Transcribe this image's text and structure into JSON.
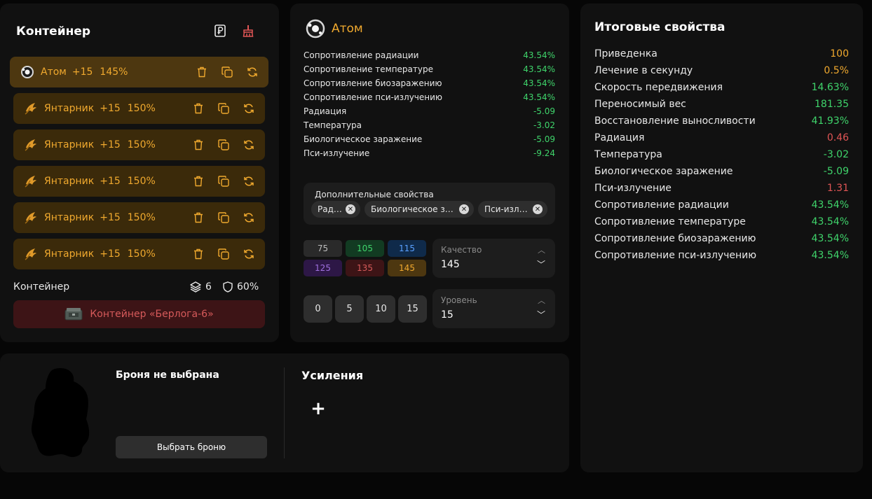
{
  "container_panel": {
    "title": "Контейнер",
    "artifacts": [
      {
        "name": "Атом",
        "level": "+15",
        "quality": "145%",
        "active": true
      },
      {
        "name": "Янтарник",
        "level": "+15",
        "quality": "150%",
        "active": false
      },
      {
        "name": "Янтарник",
        "level": "+15",
        "quality": "150%",
        "active": false
      },
      {
        "name": "Янтарник",
        "level": "+15",
        "quality": "150%",
        "active": false
      },
      {
        "name": "Янтарник",
        "level": "+15",
        "quality": "150%",
        "active": false
      },
      {
        "name": "Янтарник",
        "level": "+15",
        "quality": "150%",
        "active": false
      }
    ],
    "footer_label": "Контейнер",
    "slots": "6",
    "protection": "60%",
    "selected_container": "Контейнер «Берлога-6»"
  },
  "artifact_panel": {
    "name": "Атом",
    "properties": [
      {
        "label": "Сопротивление радиации",
        "value": "43.54%"
      },
      {
        "label": "Сопротивление температуре",
        "value": "43.54%"
      },
      {
        "label": "Сопротивление биозаражению",
        "value": "43.54%"
      },
      {
        "label": "Сопротивление пси-излучению",
        "value": "43.54%"
      },
      {
        "label": "Радиация",
        "value": "-5.09"
      },
      {
        "label": "Температура",
        "value": "-3.02"
      },
      {
        "label": "Биологическое заражение",
        "value": "-5.09"
      },
      {
        "label": "Пси-излучение",
        "value": "-9.24"
      }
    ],
    "extra_title": "Дополнительные свойства",
    "extra_chips": [
      "Радиация",
      "Биологическое заражение",
      "Пси-излучение"
    ],
    "quality_buttons": [
      {
        "label": "75",
        "bg": "#2a2a2a",
        "fg": "#bdbdbd"
      },
      {
        "label": "105",
        "bg": "#123b22",
        "fg": "#3fd46b"
      },
      {
        "label": "115",
        "bg": "#0f2a4a",
        "fg": "#5aa0ff"
      },
      {
        "label": "125",
        "bg": "#2d1746",
        "fg": "#a070e0"
      },
      {
        "label": "135",
        "bg": "#3d1416",
        "fg": "#d65a5a"
      },
      {
        "label": "145",
        "bg": "#4d3710",
        "fg": "#f0a92e"
      }
    ],
    "quality_label": "Качество",
    "quality_value": "145",
    "level_buttons": [
      "0",
      "5",
      "10",
      "15"
    ],
    "level_label": "Уровень",
    "level_value": "15"
  },
  "totals_panel": {
    "title": "Итоговые свойства",
    "rows": [
      {
        "label": "Приведенка",
        "value": "100",
        "color": "#f0a92e"
      },
      {
        "label": "Лечение в секунду",
        "value": "0.5%",
        "color": "#f0a92e"
      },
      {
        "label": "Скорость передвижения",
        "value": "14.63%",
        "color": "#3fd46b"
      },
      {
        "label": "Переносимый вес",
        "value": "181.35",
        "color": "#3fd46b"
      },
      {
        "label": "Восстановление выносливости",
        "value": "41.93%",
        "color": "#3fd46b"
      },
      {
        "label": "Радиация",
        "value": "0.46",
        "color": "#e05555"
      },
      {
        "label": "Температура",
        "value": "-3.02",
        "color": "#3fd46b"
      },
      {
        "label": "Биологическое заражение",
        "value": "-5.09",
        "color": "#3fd46b"
      },
      {
        "label": "Пси-излучение",
        "value": "1.31",
        "color": "#e05555"
      },
      {
        "label": "Сопротивление радиации",
        "value": "43.54%",
        "color": "#3fd46b"
      },
      {
        "label": "Сопротивление температуре",
        "value": "43.54%",
        "color": "#3fd46b"
      },
      {
        "label": "Сопротивление биозаражению",
        "value": "43.54%",
        "color": "#3fd46b"
      },
      {
        "label": "Сопротивление пси-излучению",
        "value": "43.54%",
        "color": "#3fd46b"
      }
    ]
  },
  "armor_panel": {
    "title": "Броня не выбрана",
    "select_button": "Выбрать броню",
    "boosts_title": "Усиления",
    "add_symbol": "+"
  },
  "colors": {
    "accent": "#f0a92e",
    "positive": "#3fd46b",
    "negative": "#e05555",
    "container_red": "#d65a5a"
  }
}
